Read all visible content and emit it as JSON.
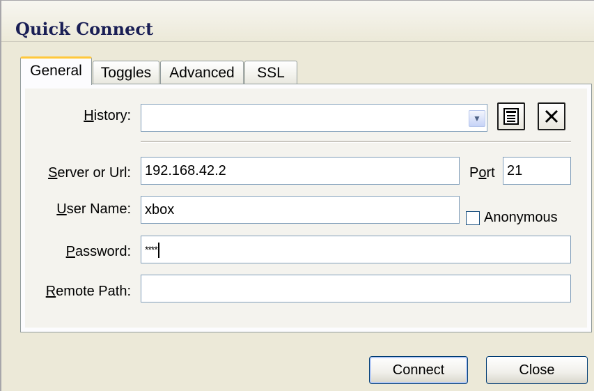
{
  "window": {
    "title": "Quick Connect"
  },
  "tabs": [
    {
      "label": "General",
      "active": true
    },
    {
      "label": "Toggles",
      "active": false
    },
    {
      "label": "Advanced",
      "active": false
    },
    {
      "label": "SSL",
      "active": false
    }
  ],
  "form": {
    "history": {
      "label_pre": "",
      "label_key": "H",
      "label_post": "istory:",
      "value": ""
    },
    "server": {
      "label_pre": "",
      "label_key": "S",
      "label_post": "erver or Url:",
      "value": "192.168.42.2"
    },
    "port": {
      "label_pre": "P",
      "label_key": "o",
      "label_post": "rt",
      "value": "21"
    },
    "username": {
      "label_pre": "",
      "label_key": "U",
      "label_post": "ser Name:",
      "value": "xbox"
    },
    "anonymous": {
      "label": "Anonymous",
      "checked": false
    },
    "password": {
      "label_pre": "",
      "label_key": "P",
      "label_post": "assword:",
      "value": "****"
    },
    "remote_path": {
      "label_pre": "",
      "label_key": "R",
      "label_post": "emote Path:",
      "value": ""
    }
  },
  "buttons": {
    "connect": "Connect",
    "close": "Close"
  },
  "icons": {
    "history_dropdown": "chevron-down-icon",
    "history_list": "list-icon",
    "history_clear": "close-icon"
  },
  "colors": {
    "face": "#ECE9D8",
    "tab_highlight": "#FFC83C",
    "input_border": "#7F9DB9",
    "title_text": "#1A1F55"
  }
}
